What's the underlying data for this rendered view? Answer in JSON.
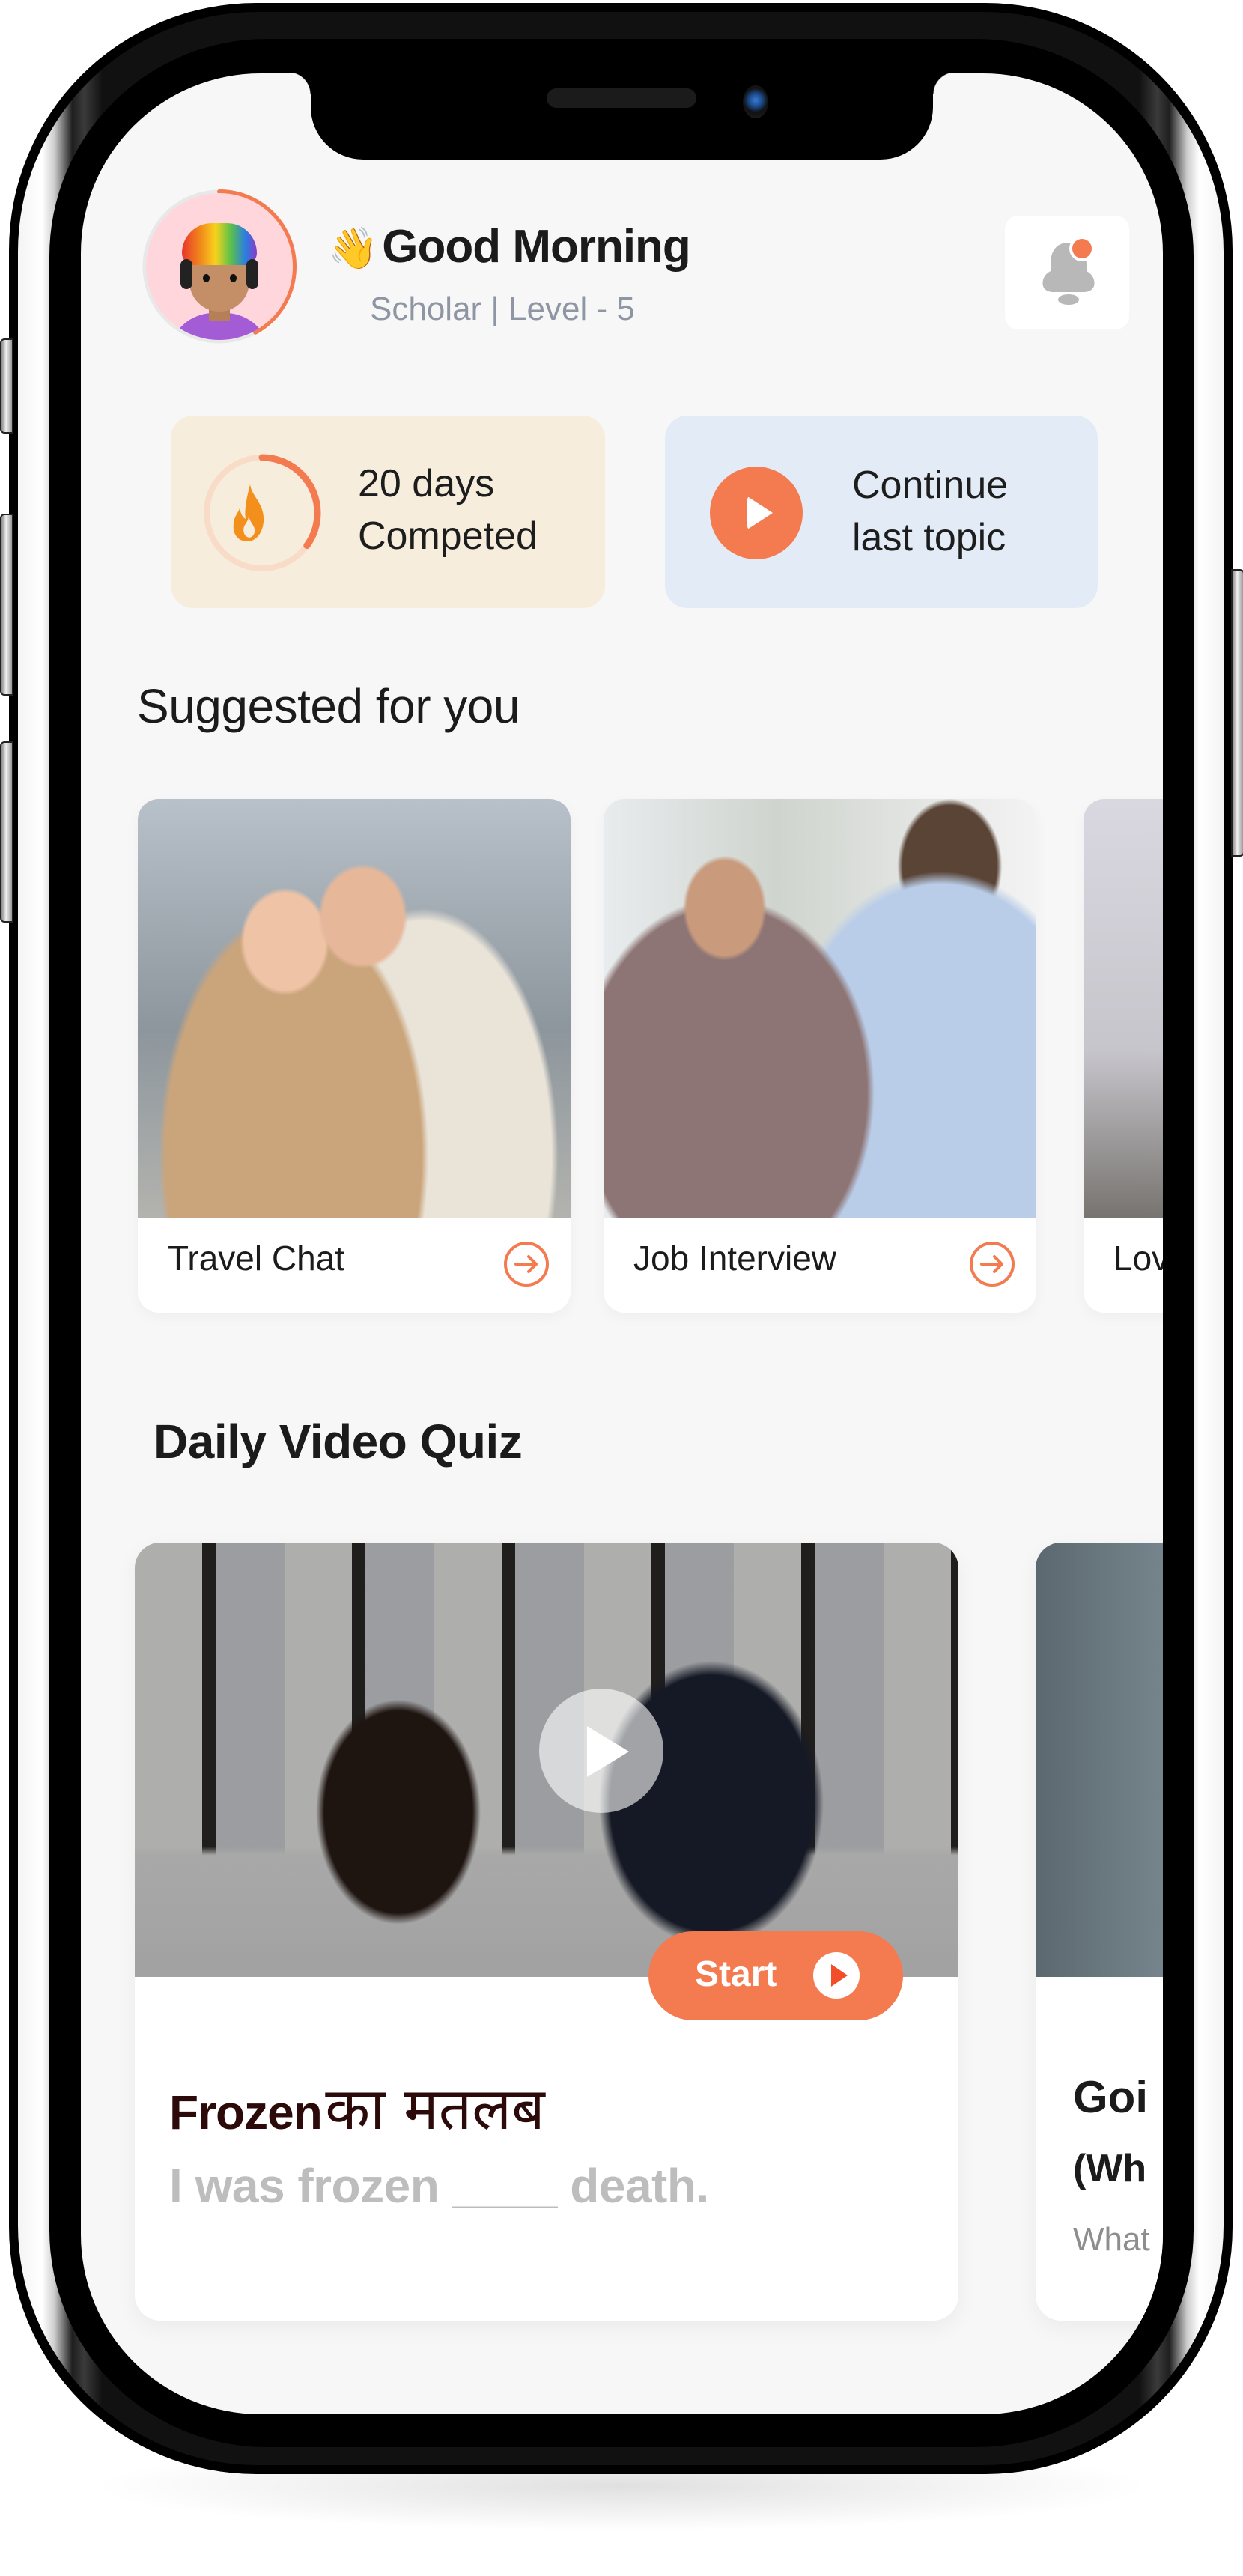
{
  "colors": {
    "accent": "#f47a50",
    "screen_bg": "#f7f7f7",
    "streak_card_bg": "#f7eddd",
    "continue_card_bg": "#e3ecf6",
    "quiz_headline": "#2d0a0a",
    "quiz_sentence": "#bdbdbd",
    "subtitle": "#8e95a3",
    "bell": "#b8b8b8"
  },
  "header": {
    "avatar_icon": "avatar-3d-character",
    "avatar_progress": 0.42,
    "wave_emoji": "👋",
    "greeting": "Good Morning",
    "subtitle": "Scholar |  Level - 5",
    "notification_icon": "bell-icon",
    "has_unread_notification": true
  },
  "stats": {
    "streak": {
      "icon": "flame-icon",
      "progress": 0.35,
      "line1": "20 days",
      "line2": "Competed"
    },
    "continue": {
      "icon": "play-icon",
      "line1": "Continue",
      "line2": "last topic"
    }
  },
  "suggested": {
    "title": "Suggested for you",
    "items": [
      {
        "label": "Travel Chat",
        "image": "travel-couple-photo",
        "icon": "arrow-right-circle-icon"
      },
      {
        "label": "Job Interview",
        "image": "job-interview-handshake-photo",
        "icon": "arrow-right-circle-icon"
      },
      {
        "label": "Lov",
        "image": "man-on-couch-photo",
        "icon": "arrow-right-circle-icon"
      }
    ]
  },
  "daily_quiz": {
    "title": "Daily Video Quiz",
    "cards": [
      {
        "image": "two-women-meeting-photo",
        "play_icon": "play-icon",
        "start_label": "Start",
        "headline_en": "Frozen",
        "headline_hi": "का मतलब",
        "sentence": "I was frozen ____ death."
      },
      {
        "image": "teal-background-photo",
        "title": "Goi",
        "subtitle": "(Wh",
        "question": "What"
      }
    ]
  }
}
